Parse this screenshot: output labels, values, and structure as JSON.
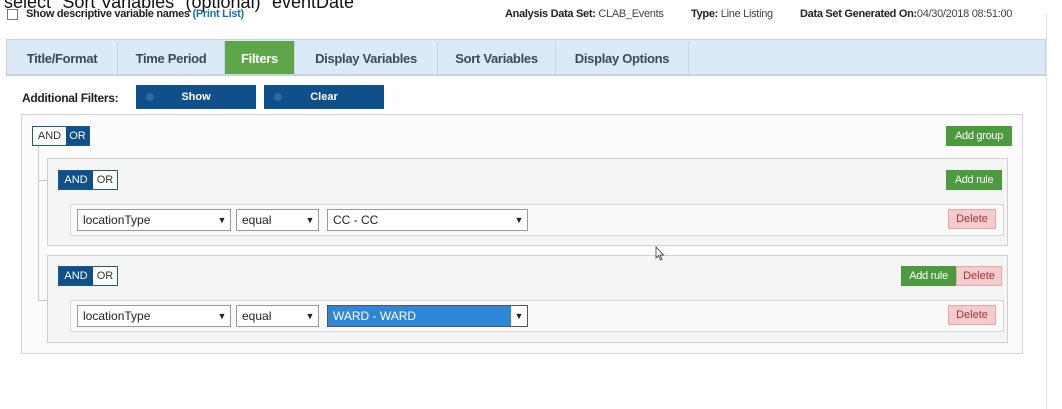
{
  "caption": "select \"Sort Variables\" (optional) \"eventDate\"",
  "header": {
    "descriptive_label": "Show descriptive variable names",
    "print_link": "(Print List)",
    "analysis_label": "Analysis Data Set:",
    "analysis_value": "CLAB_Events",
    "type_label": "Type:",
    "type_value": "Line Listing",
    "generated_label": "Data Set Generated On:",
    "generated_value": "04/30/2018 08:51:00"
  },
  "tabs": [
    {
      "label": "Title/Format",
      "active": false
    },
    {
      "label": "Time Period",
      "active": false
    },
    {
      "label": "Filters",
      "active": true
    },
    {
      "label": "Display Variables",
      "active": false
    },
    {
      "label": "Sort Variables",
      "active": false
    },
    {
      "label": "Display Options",
      "active": false
    }
  ],
  "filters": {
    "label": "Additional Filters:",
    "show_label": "Show",
    "clear_label": "Clear",
    "and_label": "AND",
    "or_label": "OR",
    "add_group_label": "Add group",
    "add_rule_label": "Add rule",
    "delete_label": "Delete",
    "groups": [
      {
        "field": "locationType",
        "operator": "equal",
        "value": "CC - CC"
      },
      {
        "field": "locationType",
        "operator": "equal",
        "value": "WARD - WARD"
      }
    ]
  },
  "colors": {
    "active_tab": "#5fa54a",
    "primary": "#0f4f8a",
    "add_button": "#4c9a3e",
    "delete_button": "#f4cccc",
    "selection": "#2f86d6"
  }
}
